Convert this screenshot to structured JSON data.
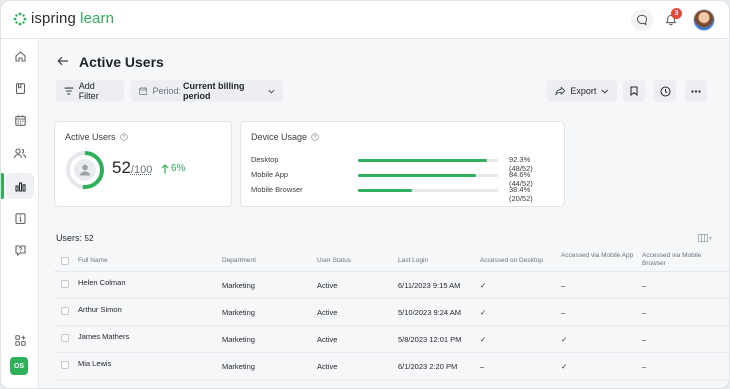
{
  "header": {
    "logo_brand": "ispring",
    "logo_product": "learn",
    "notification_count": "3"
  },
  "sidebar": {
    "items": [
      {
        "icon": "home-icon"
      },
      {
        "icon": "book-icon"
      },
      {
        "icon": "calendar-icon"
      },
      {
        "icon": "users-icon"
      },
      {
        "icon": "reports-icon",
        "active": true
      },
      {
        "icon": "info-icon"
      },
      {
        "icon": "help-icon"
      }
    ],
    "apps_icon": "add-apps-icon",
    "account_initials": "OS"
  },
  "page": {
    "title": "Active Users",
    "add_filter": "Add Filter",
    "period_label": "Period:",
    "period_value": "Current billing period",
    "export": "Export"
  },
  "active_users_card": {
    "title": "Active Users",
    "active": "52",
    "total": "100",
    "total_display": "/100",
    "trend": "6%",
    "fraction": 0.52
  },
  "device_usage": {
    "title": "Device Usage",
    "rows": [
      {
        "label": "Desktop",
        "value": "92.3% (48/52)",
        "percent": 92.3
      },
      {
        "label": "Mobile App",
        "value": "84.6% (44/52)",
        "percent": 84.6
      },
      {
        "label": "Mobile Browser",
        "value": "38.4% (20/52)",
        "percent": 38.4
      }
    ]
  },
  "users_table": {
    "count_label": "Users:",
    "count": "52",
    "columns": [
      "Full Name",
      "Department",
      "User Status",
      "Last Login",
      "Accessed on Desktop",
      "Accessed via Mobile App",
      "Accessed via Mobile Browser"
    ],
    "rows": [
      {
        "name": "Helen Colman",
        "department": "Marketing",
        "status": "Active",
        "last_login": "6/11/2023 9:15 AM",
        "desktop": "✓",
        "mobile_app": "–",
        "mobile_browser": "–"
      },
      {
        "name": "Arthur Simon",
        "department": "Marketing",
        "status": "Active",
        "last_login": "5/10/2023 9:24 AM",
        "desktop": "✓",
        "mobile_app": "–",
        "mobile_browser": "–"
      },
      {
        "name": "James Mathers",
        "department": "Marketing",
        "status": "Active",
        "last_login": "5/8/2023 12:01 PM",
        "desktop": "✓",
        "mobile_app": "✓",
        "mobile_browser": "–"
      },
      {
        "name": "Mia Lewis",
        "department": "Marketing",
        "status": "Active",
        "last_login": "6/1/2023 2:20 PM",
        "desktop": "–",
        "mobile_app": "✓",
        "mobile_browser": "–"
      }
    ]
  },
  "colors": {
    "accent": "#2eb05b",
    "badge": "#e5483b"
  }
}
